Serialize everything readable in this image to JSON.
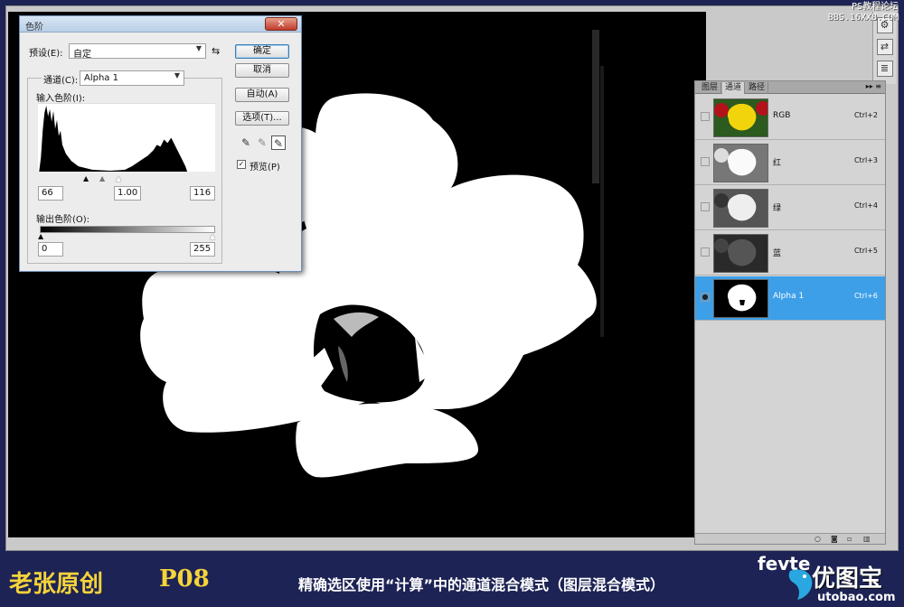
{
  "watermark": {
    "line1": "PS教程论坛",
    "line2": "BBS.16XX8.COM"
  },
  "levels": {
    "title": "色阶",
    "close": "✕",
    "preset_label": "预设(E):",
    "preset_value": "自定",
    "channel_label": "通道(C):",
    "channel_value": "Alpha 1",
    "input_label": "输入色阶(I):",
    "input_black": "66",
    "input_gamma": "1.00",
    "input_white": "116",
    "output_label": "输出色阶(O):",
    "output_black": "0",
    "output_white": "255",
    "ok": "确定",
    "cancel": "取消",
    "auto": "自动(A)",
    "options": "选项(T)...",
    "preview": "预览(P)",
    "preview_checked": "✓"
  },
  "channels": {
    "tabs": [
      "图层",
      "通道",
      "路径"
    ],
    "menu": "▸▸ ≡",
    "rows": [
      {
        "name": "RGB",
        "shortcut": "Ctrl+2"
      },
      {
        "name": "红",
        "shortcut": "Ctrl+3"
      },
      {
        "name": "绿",
        "shortcut": "Ctrl+4"
      },
      {
        "name": "蓝",
        "shortcut": "Ctrl+5"
      },
      {
        "name": "Alpha 1",
        "shortcut": "Ctrl+6"
      }
    ],
    "eye_icon": "●"
  },
  "caption": {
    "author": "老张原创",
    "page": "P08",
    "description": "精确选区使用“计算”中的通道混合模式（图层混合模式）"
  },
  "logo": {
    "en": "fevte",
    "cn": "优图宝",
    "url": "utobao.com"
  }
}
